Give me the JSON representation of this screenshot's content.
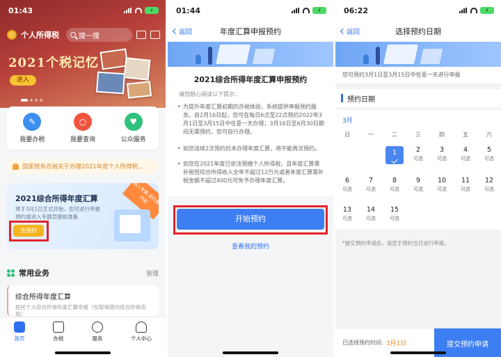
{
  "phone1": {
    "status_time": "01:43",
    "app_title": "个人所得税",
    "search_placeholder": "搜一搜",
    "banner_text": "2021个税记忆",
    "banner_button": "进入",
    "quick_actions": [
      "我要办税",
      "我要查询",
      "公众服务"
    ],
    "notice": "国家税务总局关于办理2021年度个人所得税...",
    "promo": {
      "title": "2021综合所得年度汇算",
      "desc": "将于3月1日正式开始，您可进行申报预约或进入专题页提前准备",
      "ribbon": "进入专题 进行更多内容",
      "button": "去预约"
    },
    "common_section": {
      "title": "常用业务",
      "manage": "管理"
    },
    "service_item": {
      "title": "综合所得年度汇算",
      "desc": "居民个人综合所得年度汇算申报（仅取得境内综合所得适用）"
    },
    "tabs": [
      "首页",
      "办税",
      "服务",
      "个人中心"
    ]
  },
  "phone2": {
    "status_time": "01:44",
    "back": "返回",
    "nav_title": "年度汇算申报预约",
    "heading": "2021综合所得年度汇算申报预约",
    "note": "请您耐心阅读以下提示：",
    "paragraphs": [
      "为提升年度汇算初期的办税体验，系统提供申报预约服务。自2月16日起，您可在每日6点至22点预约2022年3月1日至3月15日中任意一天办理；3月16日至6月30日期间无需预约，您可自行办理。",
      "如您连续2次预约后未办理年度汇算，将不能再次预约。",
      "如您在2021年度已依法预缴个人所得税，且年度汇算需补税但综合所得收入全年不超过12万元或者年度汇算需补税金额不超过400元可免予办理年度汇算。"
    ],
    "primary_button": "开始预约",
    "link": "查看我的预约"
  },
  "phone3": {
    "status_time": "06:22",
    "back": "返回",
    "nav_title": "选择预约日期",
    "tip": "您可预约3月1日至3月15日中任意一天进行申报",
    "section_title": "预约日期",
    "month": "3月",
    "weekdays": [
      "日",
      "一",
      "二",
      "三",
      "四",
      "五",
      "六"
    ],
    "days": [
      {
        "d": "1",
        "s": ""
      },
      {
        "d": "2",
        "s": "可选"
      },
      {
        "d": "3",
        "s": "可选"
      },
      {
        "d": "4",
        "s": "可选"
      },
      {
        "d": "5",
        "s": "可选"
      },
      {
        "d": "6",
        "s": "可选"
      },
      {
        "d": "7",
        "s": "可选"
      },
      {
        "d": "8",
        "s": "可选"
      },
      {
        "d": "9",
        "s": "可选"
      },
      {
        "d": "10",
        "s": "可选"
      },
      {
        "d": "11",
        "s": "可选"
      },
      {
        "d": "12",
        "s": "可选"
      },
      {
        "d": "13",
        "s": "可选"
      },
      {
        "d": "14",
        "s": "可选"
      },
      {
        "d": "15",
        "s": "可选"
      }
    ],
    "footnote": "*提交预约申请后，请您于预约当日进行申报。",
    "selected_label": "已选择预约时间:",
    "selected_value": "3月1日",
    "submit": "提交预约申请"
  },
  "colors": {
    "accent": "#2f6ff0",
    "highlight": "#e3222a",
    "warn": "#f4b41f"
  }
}
